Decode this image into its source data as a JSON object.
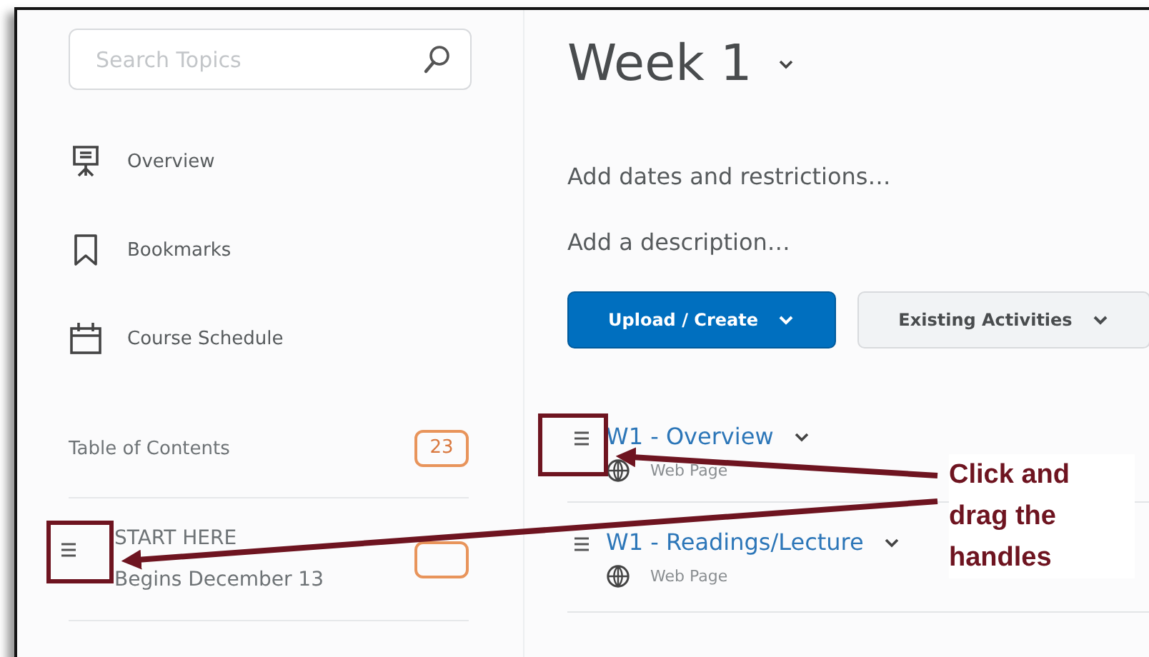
{
  "search": {
    "placeholder": "Search Topics"
  },
  "nav": [
    {
      "label": "Overview",
      "kind": "presentation"
    },
    {
      "label": "Bookmarks",
      "kind": "bookmark"
    },
    {
      "label": "Course Schedule",
      "kind": "calendar"
    }
  ],
  "toc": {
    "label": "Table of Contents",
    "count": "23"
  },
  "modules": [
    {
      "title": "START HERE",
      "subtitle": "Begins December 13"
    }
  ],
  "week": {
    "title": "Week 1"
  },
  "links": [
    "Add dates and restrictions…",
    "Add a description…"
  ],
  "buttons": [
    {
      "label": "Upload / Create",
      "kind": "primary"
    },
    {
      "label": "Existing Activities",
      "kind": "secondary"
    }
  ],
  "topics": [
    {
      "title": "W1 - Overview",
      "type": "Web Page"
    },
    {
      "title": "W1 - Readings/Lecture",
      "type": "Web Page"
    }
  ],
  "callout": {
    "text": "Click and drag the handles"
  }
}
